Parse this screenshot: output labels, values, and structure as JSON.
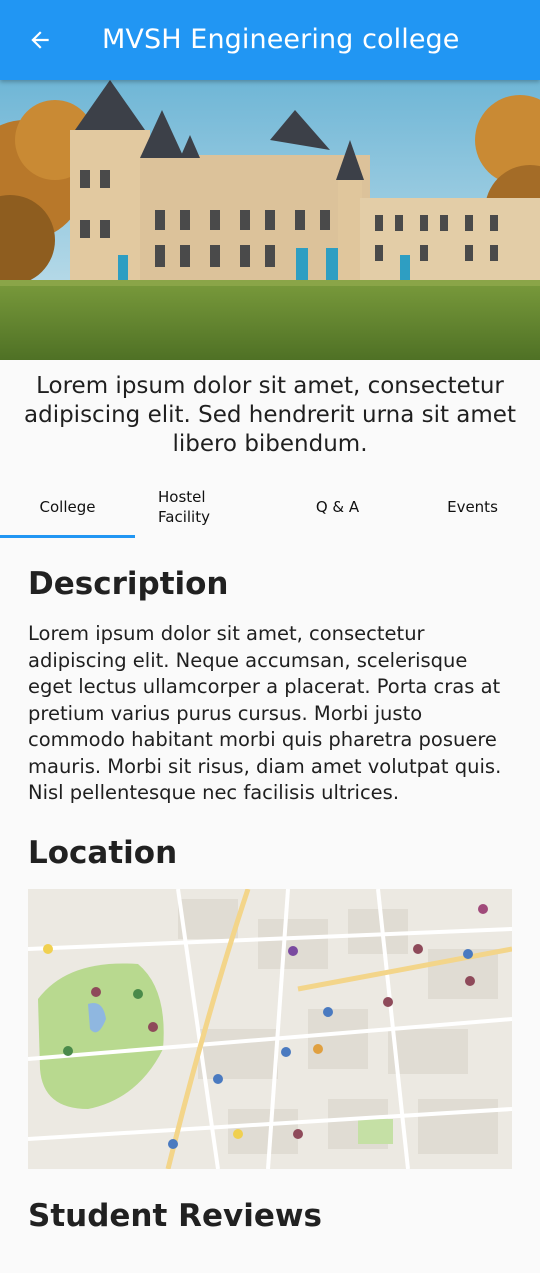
{
  "appbar": {
    "title": "MVSH Engineering college",
    "back_icon": "arrow-left-icon",
    "color": "#2196f3"
  },
  "hero": {
    "image": "college-building-photo"
  },
  "tagline": "Lorem ipsum dolor sit amet, consectetur adipiscing elit. Sed hendrerit urna sit amet libero bibendum.",
  "tabs": [
    {
      "label": "College",
      "selected": true
    },
    {
      "label": "Hostel Facility",
      "selected": false
    },
    {
      "label": "Q & A",
      "selected": false
    },
    {
      "label": "Events",
      "selected": false
    }
  ],
  "sections": {
    "description_title": "Description",
    "description_text": "Lorem ipsum dolor sit amet, consectetur adipiscing elit. Neque accumsan, scelerisque eget lectus ullamcorper a placerat. Porta cras at pretium varius purus cursus. Morbi justo commodo habitant morbi quis pharetra posuere mauris. Morbi sit risus, diam amet volutpat quis. Nisl pellentesque nec facilisis ultrices.",
    "location_title": "Location",
    "reviews_title": "Student Reviews"
  },
  "map": {
    "image": "city-map"
  }
}
